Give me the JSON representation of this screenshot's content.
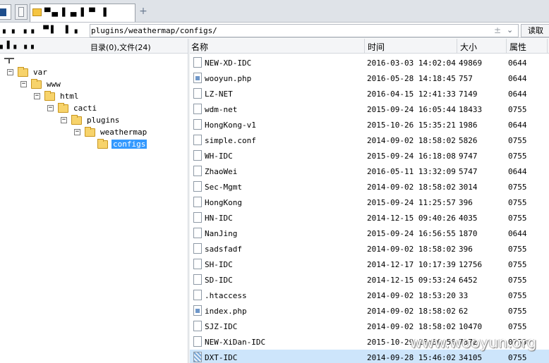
{
  "tabs": [
    {
      "title": ""
    },
    {
      "title": ""
    },
    {
      "title": "▀▄▐ ▄▐ ▀ ▐"
    }
  ],
  "address": {
    "label": "▗ ▖ ▖▖ ▀▌ ▐ ▖",
    "path": "plugins/weathermap/configs/",
    "go_label": "读取"
  },
  "left_header": {
    "status": "▖▌▖ ▖▖",
    "summary": "目录(0),文件(24)"
  },
  "tree": [
    {
      "label": "var",
      "toggle": "−"
    },
    {
      "label": "www",
      "toggle": "−"
    },
    {
      "label": "html",
      "toggle": "−"
    },
    {
      "label": "cacti",
      "toggle": "−"
    },
    {
      "label": "plugins",
      "toggle": "−"
    },
    {
      "label": "weathermap",
      "toggle": "−"
    },
    {
      "label": "configs",
      "toggle": ""
    }
  ],
  "columns": {
    "name": "名称",
    "time": "时间",
    "size": "大小",
    "perm": "属性"
  },
  "files": [
    {
      "name": "NEW-XD-IDC",
      "time": "2016-03-03 14:02:04",
      "size": "49869",
      "perm": "0644",
      "icon": "file"
    },
    {
      "name": "wooyun.php",
      "time": "2016-05-28 14:18:45",
      "size": "757",
      "perm": "0644",
      "icon": "php"
    },
    {
      "name": "LZ-NET",
      "time": "2016-04-15 12:41:33",
      "size": "7149",
      "perm": "0644",
      "icon": "file"
    },
    {
      "name": "wdm-net",
      "time": "2015-09-24 16:05:44",
      "size": "18433",
      "perm": "0755",
      "icon": "file"
    },
    {
      "name": "HongKong-v1",
      "time": "2015-10-26 15:35:21",
      "size": "1986",
      "perm": "0644",
      "icon": "file"
    },
    {
      "name": "simple.conf",
      "time": "2014-09-02 18:58:02",
      "size": "5826",
      "perm": "0755",
      "icon": "file"
    },
    {
      "name": "WH-IDC",
      "time": "2015-09-24 16:18:08",
      "size": "9747",
      "perm": "0755",
      "icon": "file"
    },
    {
      "name": "ZhaoWei",
      "time": "2016-05-11 13:32:09",
      "size": "5747",
      "perm": "0644",
      "icon": "file"
    },
    {
      "name": "Sec-Mgmt",
      "time": "2014-09-02 18:58:02",
      "size": "3014",
      "perm": "0755",
      "icon": "file"
    },
    {
      "name": "HongKong",
      "time": "2015-09-24 11:25:57",
      "size": "396",
      "perm": "0755",
      "icon": "file"
    },
    {
      "name": "HN-IDC",
      "time": "2014-12-15 09:40:26",
      "size": "4035",
      "perm": "0755",
      "icon": "file"
    },
    {
      "name": "NanJing",
      "time": "2015-09-24 16:56:55",
      "size": "1870",
      "perm": "0644",
      "icon": "file"
    },
    {
      "name": "sadsfadf",
      "time": "2014-09-02 18:58:02",
      "size": "396",
      "perm": "0755",
      "icon": "file"
    },
    {
      "name": "SH-IDC",
      "time": "2014-12-17 10:17:39",
      "size": "12756",
      "perm": "0755",
      "icon": "file"
    },
    {
      "name": "SD-IDC",
      "time": "2014-12-15 09:53:24",
      "size": "6452",
      "perm": "0755",
      "icon": "file"
    },
    {
      "name": ".htaccess",
      "time": "2014-09-02 18:53:20",
      "size": "33",
      "perm": "0755",
      "icon": "file"
    },
    {
      "name": "index.php",
      "time": "2014-09-02 18:58:02",
      "size": "62",
      "perm": "0755",
      "icon": "php"
    },
    {
      "name": "SJZ-IDC",
      "time": "2014-09-02 18:58:02",
      "size": "10470",
      "perm": "0755",
      "icon": "file"
    },
    {
      "name": "NEW-XiDan-IDC",
      "time": "2015-10-29 18:30:56",
      "size": "7372",
      "perm": "0755",
      "icon": "file"
    },
    {
      "name": "DXT-IDC",
      "time": "2014-09-28 15:46:02",
      "size": "34105",
      "perm": "0755",
      "icon": "img"
    }
  ],
  "watermark": "www.wooyun.org",
  "colors": {
    "selection": "#3399ff",
    "selected_row": "#cde5fb",
    "folder": "#f7d36b"
  }
}
